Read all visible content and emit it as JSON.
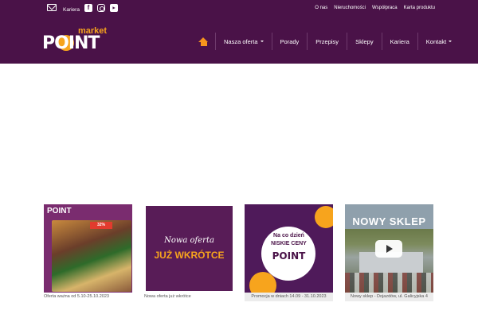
{
  "topbar": {
    "career_label": "Kariera",
    "links": [
      "O nas",
      "Nieruchomości",
      "Współpraca",
      "Karta produktu"
    ]
  },
  "logo": {
    "market": "market",
    "point": "POINT"
  },
  "nav": {
    "items": [
      {
        "label": "Nasza oferta",
        "dropdown": true
      },
      {
        "label": "Porady",
        "dropdown": false
      },
      {
        "label": "Przepisy",
        "dropdown": false
      },
      {
        "label": "Sklepy",
        "dropdown": false
      },
      {
        "label": "Kariera",
        "dropdown": false
      },
      {
        "label": "Kontakt",
        "dropdown": true
      }
    ]
  },
  "cards": [
    {
      "caption": "Oferta ważna od 5.10-25.10.2023",
      "mini_logo": "POINT",
      "tag": "32%"
    },
    {
      "caption": "Nowa oferta już wkrótce",
      "line1": "Nowa oferta",
      "line2": "JUŻ WKRÓTCE"
    },
    {
      "caption": "Promocja w dniach 14.09 - 31.10.2023",
      "line1": "Na co dzień",
      "line2": "NISKIE CENY",
      "brand": "POINT"
    },
    {
      "caption": "Nowy sklep - Dojazdów, ul. Galicyjska 4",
      "banner": "NOWY SKLEP"
    }
  ],
  "colors": {
    "header_bg": "#4a1248",
    "accent": "#f7a41d"
  },
  "icons": [
    "mail-icon",
    "facebook-icon",
    "instagram-icon",
    "youtube-icon",
    "home-icon",
    "play-icon"
  ]
}
